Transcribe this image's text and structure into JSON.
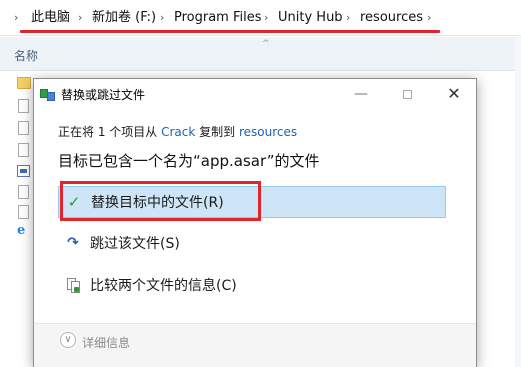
{
  "explorer": {
    "breadcrumbs": [
      "此电脑",
      "新加卷 (F:)",
      "Program Files",
      "Unity Hub",
      "resources"
    ],
    "separator": "›",
    "column_name": "名称",
    "sort_indicator": "^",
    "ie_glyph": "e"
  },
  "dialog": {
    "title": "替换或跳过文件",
    "min_glyph": "—",
    "close_glyph": "✕",
    "progress": {
      "prefix": "正在将 1 个项目从 ",
      "source": "Crack",
      "middle": " 复制到 ",
      "destination": "resources"
    },
    "heading": "目标已包含一个名为“app.asar”的文件",
    "options": {
      "replace": {
        "icon": "checkmark-icon",
        "glyph": "✓",
        "label": "替换目标中的文件(R)"
      },
      "skip": {
        "icon": "skip-arrow-icon",
        "glyph": "↷",
        "label": "跳过该文件(S)"
      },
      "compare": {
        "icon": "compare-files-icon",
        "label": "比较两个文件的信息(C)"
      }
    },
    "details": {
      "glyph": "∨",
      "label": "详细信息"
    }
  },
  "colors": {
    "highlight": "#e0262d",
    "selection": "#cde5f7",
    "link": "#1e62b4"
  }
}
